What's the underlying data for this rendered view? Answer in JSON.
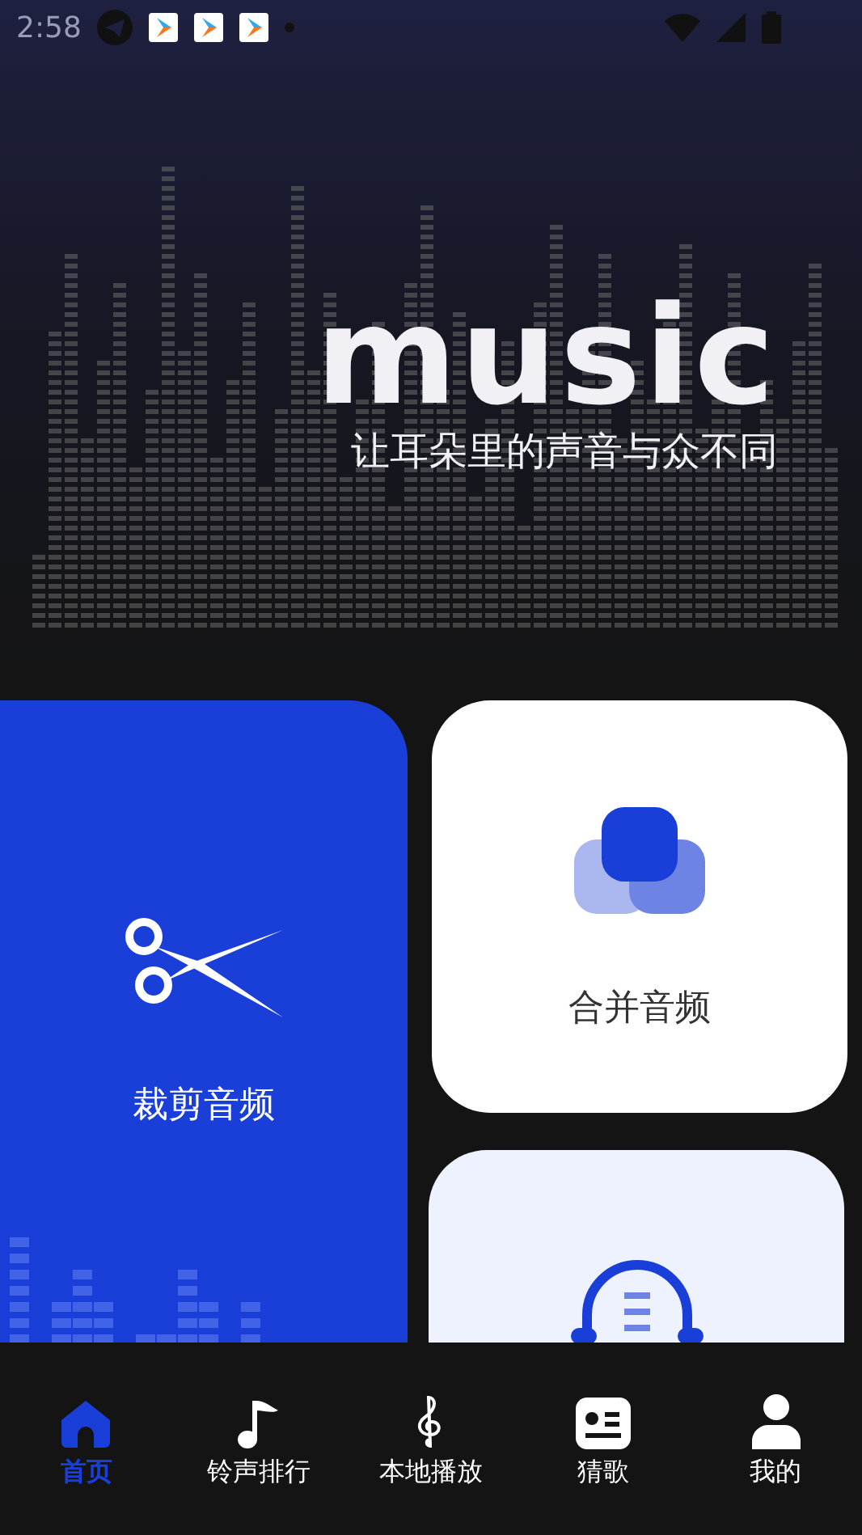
{
  "status_bar": {
    "time": "2:58"
  },
  "header": {
    "logo": "music",
    "slogan": "让耳朵里的声音与众不同"
  },
  "cards": [
    {
      "kind": "cut",
      "label": "裁剪音频"
    },
    {
      "kind": "merge",
      "label": "合并音频"
    },
    {
      "kind": "record"
    }
  ],
  "nav": [
    {
      "kind": "home",
      "label": "首页",
      "selected": true
    },
    {
      "kind": "note",
      "label": "铃声排行",
      "selected": false
    },
    {
      "kind": "clef",
      "label": "本地播放",
      "selected": false
    },
    {
      "kind": "card",
      "label": "猜歌",
      "selected": false
    },
    {
      "kind": "user",
      "label": "我的",
      "selected": false
    }
  ]
}
